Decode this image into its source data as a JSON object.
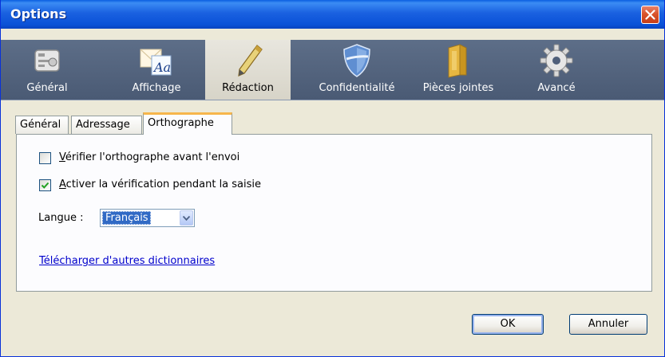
{
  "window": {
    "title": "Options"
  },
  "panes": [
    {
      "label": "Général",
      "icon": "general-icon",
      "active": false
    },
    {
      "label": "Affichage",
      "icon": "display-icon",
      "active": false
    },
    {
      "label": "Rédaction",
      "icon": "pen-icon",
      "active": true
    },
    {
      "label": "Confidentialité",
      "icon": "shield-icon",
      "active": false
    },
    {
      "label": "Pièces jointes",
      "icon": "folder-icon",
      "active": false
    },
    {
      "label": "Avancé",
      "icon": "gear-icon",
      "active": false
    }
  ],
  "tabs": [
    {
      "label": "Général",
      "active": false
    },
    {
      "label": "Adressage",
      "active": false
    },
    {
      "label": "Orthographe",
      "active": true
    }
  ],
  "spelling": {
    "check_before_send": {
      "mnemonic": "V",
      "rest": "érifier l'orthographe avant l'envoi",
      "checked": false
    },
    "check_while_typing": {
      "mnemonic": "A",
      "rest": "ctiver la vérification pendant la saisie",
      "checked": true
    },
    "language": {
      "label_pre": "Lan",
      "label_mnemonic": "g",
      "label_post": "ue :",
      "value": "Français"
    },
    "download_link": "Télécharger d'autres dictionnaires"
  },
  "buttons": {
    "ok": "OK",
    "cancel": "Annuler"
  },
  "colors": {
    "titlebar": "#0a5ee0",
    "toolbar": "#4f5f7a",
    "tab_accent": "#f7b64b",
    "link": "#0000cc",
    "selection": "#316ac5"
  }
}
